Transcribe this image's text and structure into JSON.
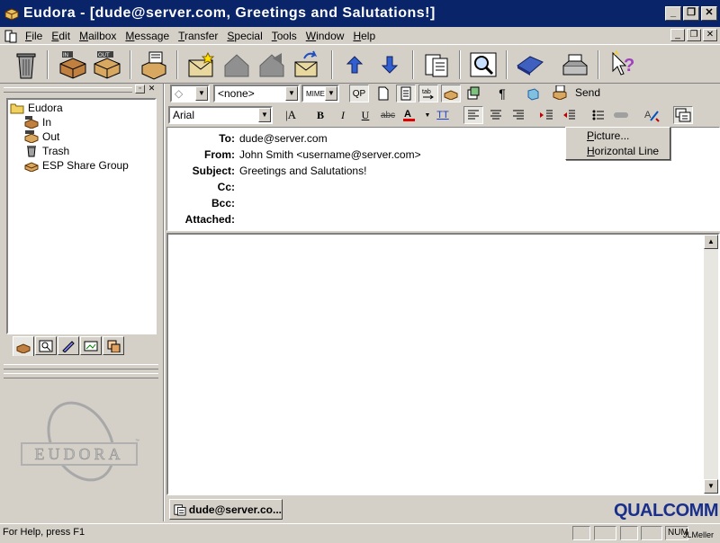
{
  "window": {
    "title": "Eudora - [dude@server.com, Greetings and Salutations!]"
  },
  "menu": [
    "File",
    "Edit",
    "Mailbox",
    "Message",
    "Transfer",
    "Special",
    "Tools",
    "Window",
    "Help"
  ],
  "mailboxes": [
    {
      "label": "Eudora",
      "icon": "folder-icon"
    },
    {
      "label": "In",
      "icon": "in-mailbox-icon"
    },
    {
      "label": "Out",
      "icon": "out-mailbox-icon"
    },
    {
      "label": "Trash",
      "icon": "trash-icon"
    },
    {
      "label": "ESP Share Group",
      "icon": "share-group-icon"
    }
  ],
  "compose": {
    "signature_select": "<none>",
    "encoding_label": "MIME",
    "qp_label": "QP",
    "send_label": "Send",
    "font_select": "Arial"
  },
  "headers": {
    "to_label": "To:",
    "to_value": "dude@server.com",
    "from_label": "From:",
    "from_value": "John Smith <username@server.com>",
    "subject_label": "Subject:",
    "subject_value": "Greetings and Salutations!",
    "cc_label": "Cc:",
    "cc_value": "",
    "bcc_label": "Bcc:",
    "bcc_value": "",
    "attached_label": "Attached:",
    "attached_value": ""
  },
  "insert_menu": {
    "items": [
      "Picture...",
      "Horizontal Line"
    ]
  },
  "taskbar": {
    "window_button": "dude@server.co..."
  },
  "brand": {
    "qualcomm": "QUALCOMM",
    "eudora": "EUDORA"
  },
  "status": {
    "help": "For Help, press F1",
    "num": "NUM",
    "user": "JLMeller"
  }
}
